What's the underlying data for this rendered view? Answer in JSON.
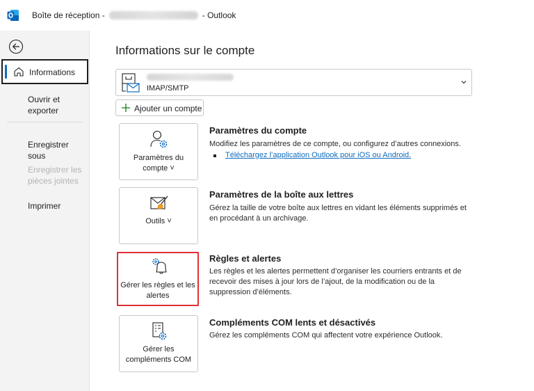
{
  "window": {
    "title_prefix": "Boîte de réception -",
    "title_suffix": "- Outlook",
    "app_icon": "outlook-icon"
  },
  "sidebar": {
    "back_icon": "back-arrow-icon",
    "items": [
      {
        "label": "Informations",
        "icon": "home-icon",
        "active": true,
        "disabled": false
      },
      {
        "label": "Ouvrir et exporter",
        "active": false,
        "disabled": false
      },
      {
        "label": "Enregistrer sous",
        "active": false,
        "disabled": false
      },
      {
        "label": "Enregistrer les pièces jointes",
        "active": false,
        "disabled": true
      },
      {
        "label": "Imprimer",
        "active": false,
        "disabled": false
      }
    ]
  },
  "main": {
    "title": "Informations sur le compte",
    "account": {
      "type": "IMAP/SMTP",
      "icon": "mail-account-icon"
    },
    "add_account_label": "Ajouter un compte",
    "sections": [
      {
        "tile_label": "Paramètres du compte ˅",
        "icon": "person-gear-icon",
        "title": "Paramètres du compte",
        "description": "Modifiez les paramètres de ce compte, ou configurez d’autres connexions.",
        "link": "Téléchargez l’application Outlook pour iOS ou Android."
      },
      {
        "tile_label": "Outils ˅",
        "icon": "mailbox-broom-icon",
        "title": "Paramètres de la boîte aux lettres",
        "description": "Gérez la taille de votre boîte aux lettres en vidant les éléments supprimés et en procédant à un archivage."
      },
      {
        "tile_label": "Gérer les règles et les alertes",
        "icon": "bell-gear-icon",
        "title": "Règles et alertes",
        "description": "Les règles et les alertes permettent d’organiser les courriers entrants et de recevoir des mises à jour lors de l’ajout, de la modification ou de la suppression d’éléments.",
        "highlighted": true
      },
      {
        "tile_label": "Gérer les compléments COM",
        "icon": "document-gear-icon",
        "title": "Compléments COM lents et désactivés",
        "description": "Gérez les compléments COM qui affectent votre expérience Outlook."
      }
    ]
  },
  "colors": {
    "accent": "#0f6cbd",
    "highlight": "#e03036",
    "sidebar_bg": "#f3f3f3"
  }
}
